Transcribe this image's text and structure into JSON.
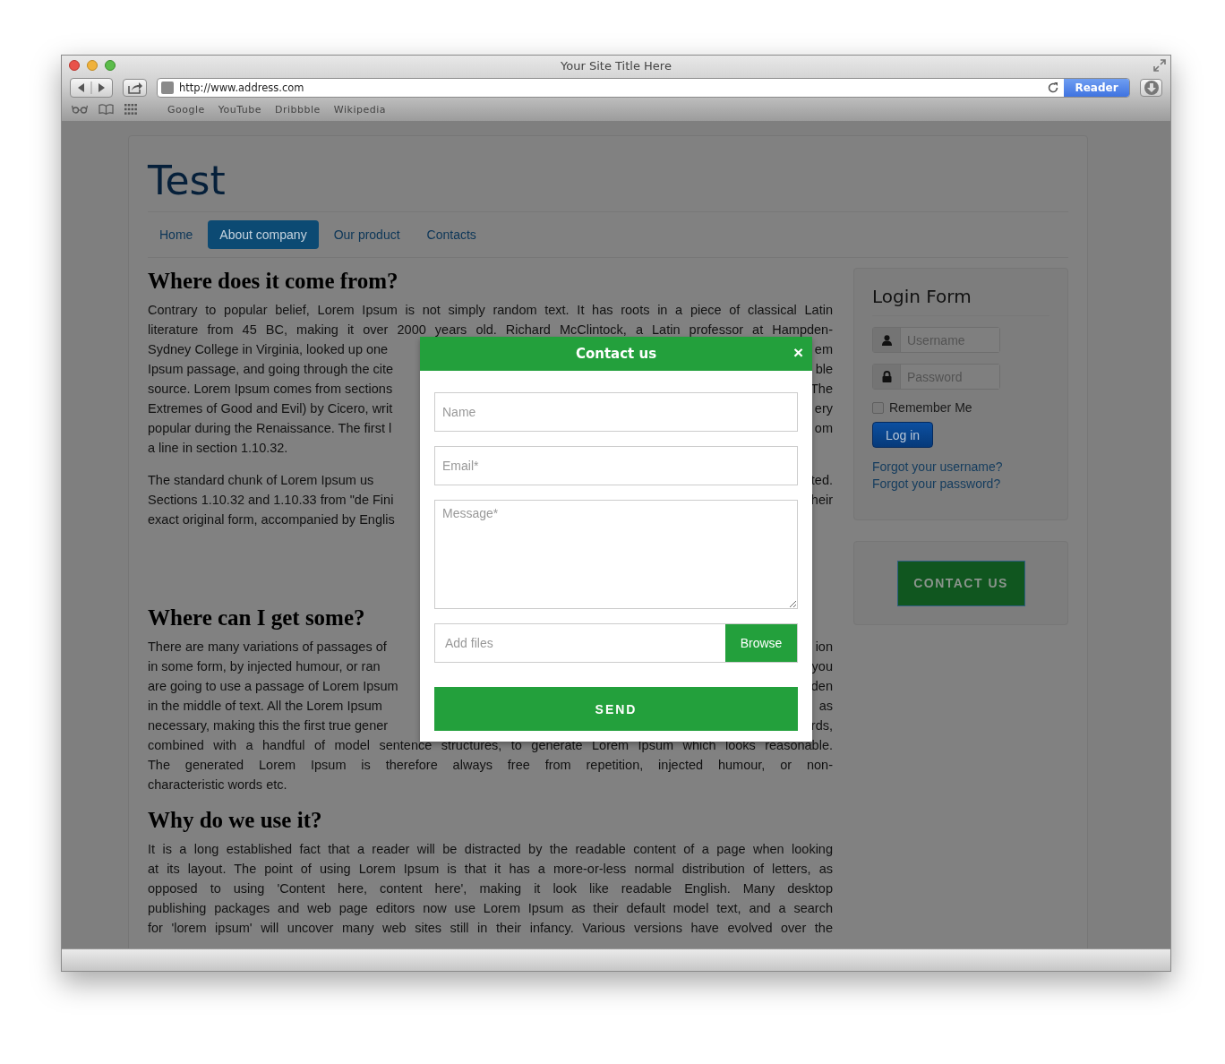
{
  "browser": {
    "title": "Your Site Title Here",
    "url": "http://www.address.com",
    "reader": "Reader",
    "bookmarks": [
      "Google",
      "YouTube",
      "Dribbble",
      "Wikipedia"
    ]
  },
  "site": {
    "title": "Test",
    "nav": [
      {
        "label": "Home",
        "selected": false
      },
      {
        "label": "About company",
        "selected": true
      },
      {
        "label": "Our product",
        "selected": false
      },
      {
        "label": "Contacts",
        "selected": false
      }
    ],
    "sections": [
      {
        "heading": "Where does it come from?",
        "paragraphs": [
          [
            {
              "kind": "full",
              "text": "Contrary to popular belief, Lorem Ipsum is not simply random text. It has roots in a piece of classical Latin"
            },
            {
              "kind": "full",
              "text": "literature from 45 BC, making it over 2000 years old. Richard McClintock, a Latin professor at Hampden-"
            },
            {
              "kind": "split",
              "left": "Sydney College in Virginia, looked up one",
              "right": "em"
            },
            {
              "kind": "split",
              "left": "Ipsum passage, and going through the cite",
              "right": "ble"
            },
            {
              "kind": "split",
              "left": "source. Lorem Ipsum comes from sections",
              "right": "The"
            },
            {
              "kind": "split",
              "left": "Extremes of Good and Evil) by Cicero, writ",
              "right": "ery"
            },
            {
              "kind": "split",
              "left": "popular during the Renaissance. The first l",
              "right": "om"
            },
            {
              "kind": "end",
              "text": "a line in section 1.10.32."
            }
          ],
          [
            {
              "kind": "split",
              "left": "The standard chunk of Lorem Ipsum us",
              "right": "ted."
            },
            {
              "kind": "split",
              "left": "Sections 1.10.32 and 1.10.33 from \"de Fini",
              "right": "heir"
            },
            {
              "kind": "end",
              "text": "exact original form, accompanied by Englis"
            }
          ]
        ]
      },
      {
        "heading": "Where can I get some?",
        "paragraphs": [
          [
            {
              "kind": "split",
              "left": "There are many variations of passages of",
              "right": "ion"
            },
            {
              "kind": "split",
              "left": "in some form, by injected humour, or ran",
              "right": "you"
            },
            {
              "kind": "split",
              "left": "are going to use a passage of Lorem Ipsum",
              "right": "den"
            },
            {
              "kind": "split",
              "left": "in the middle of text. All the Lorem Ipsum",
              "right": "as"
            },
            {
              "kind": "split",
              "left": "necessary, making this the first true gener",
              "right": "rds,"
            },
            {
              "kind": "full",
              "text": "combined with a handful of model sentence structures, to generate Lorem Ipsum which looks reasonable."
            },
            {
              "kind": "full",
              "text": "The generated Lorem Ipsum is therefore always free from repetition, injected humour, or non-"
            },
            {
              "kind": "end",
              "text": "characteristic words etc."
            }
          ]
        ]
      },
      {
        "heading": "Why do we use it?",
        "paragraphs": [
          [
            {
              "kind": "full",
              "text": "It is a long established fact that a reader will be distracted by the readable content of a page when looking"
            },
            {
              "kind": "full",
              "text": "at its layout. The point of using Lorem Ipsum is that it has a more-or-less normal distribution of letters, as"
            },
            {
              "kind": "full",
              "text": "opposed to using 'Content here, content here', making it look like readable English. Many desktop"
            },
            {
              "kind": "full",
              "text": "publishing packages and web page editors now use Lorem Ipsum as their default model text, and a search"
            },
            {
              "kind": "full",
              "text": "for 'lorem ipsum' will uncover many web sites still in their infancy. Various versions have evolved over the"
            }
          ]
        ]
      }
    ]
  },
  "login": {
    "title": "Login Form",
    "username": {
      "placeholder": "Username"
    },
    "password": {
      "placeholder": "Password"
    },
    "remember": {
      "label": "Remember Me",
      "checked": false
    },
    "button": "Log in",
    "links": [
      "Forgot your username?",
      "Forgot your password?"
    ]
  },
  "contact_button": "CONTACT US",
  "modal": {
    "title": "Contact us",
    "close": "×",
    "name": {
      "placeholder": "Name"
    },
    "email": {
      "placeholder": "Email*"
    },
    "message": {
      "placeholder": "Message*"
    },
    "files": {
      "placeholder": "Add files"
    },
    "browse": "Browse",
    "send": "SEND"
  }
}
